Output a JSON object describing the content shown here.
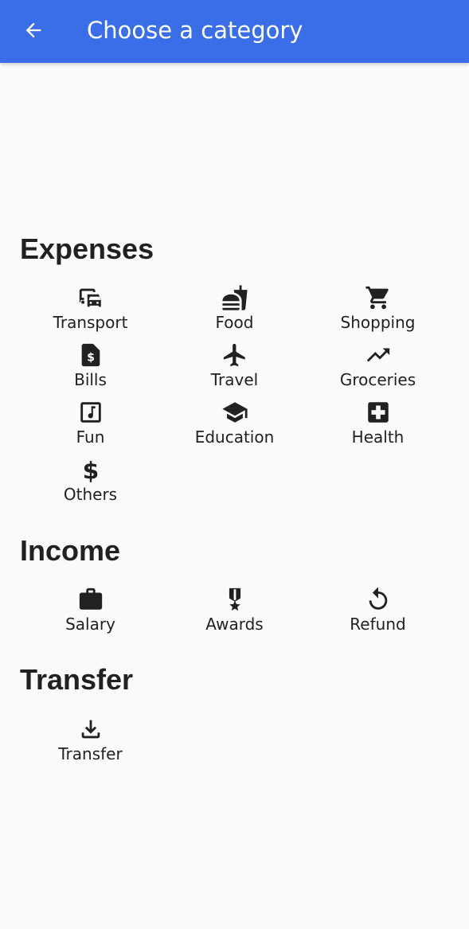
{
  "appbar": {
    "title": "Choose a category",
    "back_icon": "arrow-back-icon"
  },
  "sections": {
    "expenses": {
      "title": "Expenses",
      "items": [
        {
          "label": "Transport",
          "icon": "transport-icon"
        },
        {
          "label": "Food",
          "icon": "fastfood-icon"
        },
        {
          "label": "Shopping",
          "icon": "shopping-cart-icon"
        },
        {
          "label": "Bills",
          "icon": "bill-icon"
        },
        {
          "label": "Travel",
          "icon": "airplane-icon"
        },
        {
          "label": "Groceries",
          "icon": "trending-up-icon"
        },
        {
          "label": "Fun",
          "icon": "music-note-icon"
        },
        {
          "label": "Education",
          "icon": "graduation-cap-icon"
        },
        {
          "label": "Health",
          "icon": "medical-cross-icon"
        },
        {
          "label": "Others",
          "icon": "dollar-icon"
        }
      ]
    },
    "income": {
      "title": "Income",
      "items": [
        {
          "label": "Salary",
          "icon": "briefcase-icon"
        },
        {
          "label": "Awards",
          "icon": "military-medal-icon"
        },
        {
          "label": "Refund",
          "icon": "refresh-icon"
        }
      ]
    },
    "transfer": {
      "title": "Transfer",
      "items": [
        {
          "label": "Transfer",
          "icon": "download-icon"
        }
      ]
    }
  },
  "colors": {
    "appbar": "#3a6ee8",
    "background": "#fafafa",
    "text": "#212121"
  }
}
